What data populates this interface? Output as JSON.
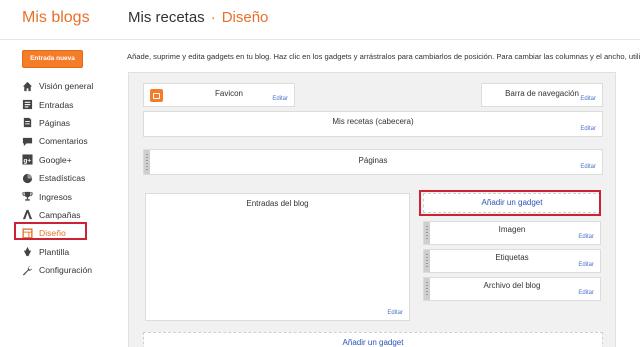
{
  "header": {
    "brand": "Mis blogs",
    "blog_name": "Mis recetas",
    "separator": "·",
    "section": "Diseño"
  },
  "sidebar": {
    "new_post_label": "Entrada nueva",
    "items": [
      {
        "label": "Visión general",
        "icon": "home-icon"
      },
      {
        "label": "Entradas",
        "icon": "posts-icon"
      },
      {
        "label": "Páginas",
        "icon": "pages-icon"
      },
      {
        "label": "Comentarios",
        "icon": "comment-icon"
      },
      {
        "label": "Google+",
        "icon": "google-plus-icon"
      },
      {
        "label": "Estadísticas",
        "icon": "stats-pie-icon"
      },
      {
        "label": "Ingresos",
        "icon": "trophy-icon"
      },
      {
        "label": "Campañas",
        "icon": "campaign-icon"
      },
      {
        "label": "Diseño",
        "icon": "layout-icon",
        "active": true
      },
      {
        "label": "Plantilla",
        "icon": "template-icon"
      },
      {
        "label": "Configuración",
        "icon": "wrench-icon"
      }
    ]
  },
  "main": {
    "intro": "Añade, suprime y edita gadgets en tu blog. Haz clic en los gadgets y arrástralos para cambiarlos de posición. Para cambiar las columnas y el ancho, utiliza el",
    "edit_label": "Editar",
    "add_gadget_label": "Añadir un gadget",
    "gadgets": {
      "favicon": "Favicon",
      "navbar": "Barra de navegación",
      "header": "Mis recetas (cabecera)",
      "pages": "Páginas",
      "blog_posts": "Entradas del blog",
      "image": "Imagen",
      "labels": "Etiquetas",
      "archive": "Archivo del blog"
    }
  },
  "colors": {
    "accent": "#e8702a",
    "button": "#f57d2a",
    "link": "#2953b3",
    "highlight": "#cc2233"
  }
}
